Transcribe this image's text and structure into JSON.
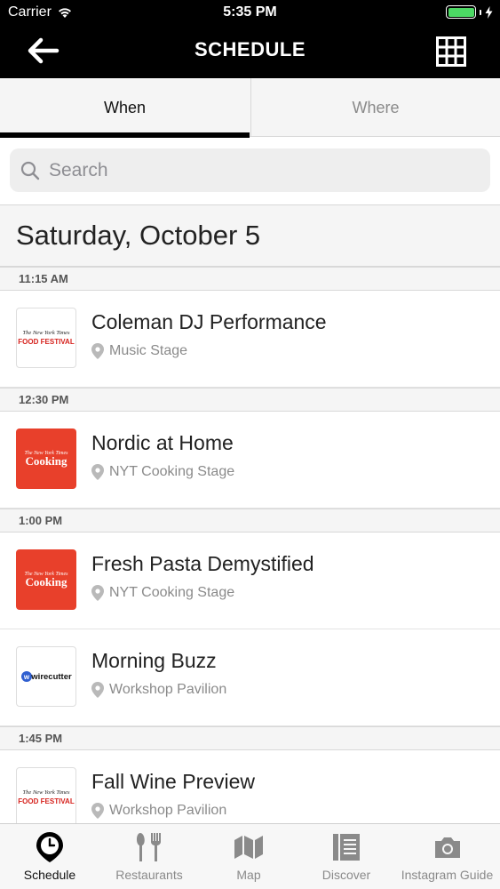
{
  "status_bar": {
    "carrier": "Carrier",
    "time": "5:35 PM",
    "battery_color": "#4cd964"
  },
  "nav": {
    "title": "SCHEDULE"
  },
  "tabs": [
    {
      "label": "When",
      "active": true
    },
    {
      "label": "Where",
      "active": false
    }
  ],
  "search": {
    "placeholder": "Search",
    "value": ""
  },
  "date_header": "Saturday, October 5",
  "schedule": [
    {
      "time": "11:15 AM",
      "events": [
        {
          "name": "Coleman DJ Performance",
          "location": "Music Stage",
          "logo": "food-festival-logo"
        }
      ]
    },
    {
      "time": "12:30 PM",
      "events": [
        {
          "name": "Nordic at Home",
          "location": "NYT Cooking Stage",
          "logo": "nyt-cooking-logo"
        }
      ]
    },
    {
      "time": "1:00 PM",
      "events": [
        {
          "name": "Fresh Pasta Demystified",
          "location": "NYT Cooking Stage",
          "logo": "nyt-cooking-logo"
        },
        {
          "name": "Morning Buzz",
          "location": "Workshop Pavilion",
          "logo": "wirecutter-logo"
        }
      ]
    },
    {
      "time": "1:45 PM",
      "events": [
        {
          "name": "Fall Wine Preview",
          "location": "Workshop Pavilion",
          "logo": "food-festival-logo"
        }
      ]
    }
  ],
  "logos": {
    "festival_top": "The New York Times",
    "festival_bottom": "FOOD FESTIVAL",
    "cooking_top": "The New York Times",
    "cooking_bottom": "Cooking",
    "wirecutter": "wirecutter"
  },
  "tabbar": [
    {
      "label": "Schedule",
      "icon": "clock-pin-icon",
      "active": true
    },
    {
      "label": "Restaurants",
      "icon": "fork-knife-icon",
      "active": false
    },
    {
      "label": "Map",
      "icon": "map-icon",
      "active": false
    },
    {
      "label": "Discover",
      "icon": "newspaper-icon",
      "active": false
    },
    {
      "label": "Instagram Guide",
      "icon": "camera-icon",
      "active": false
    }
  ],
  "colors": {
    "header_bg": "#000000",
    "cooking_red": "#e8402b",
    "festival_red": "#d6231e",
    "active_tab_underline": "#000000"
  }
}
